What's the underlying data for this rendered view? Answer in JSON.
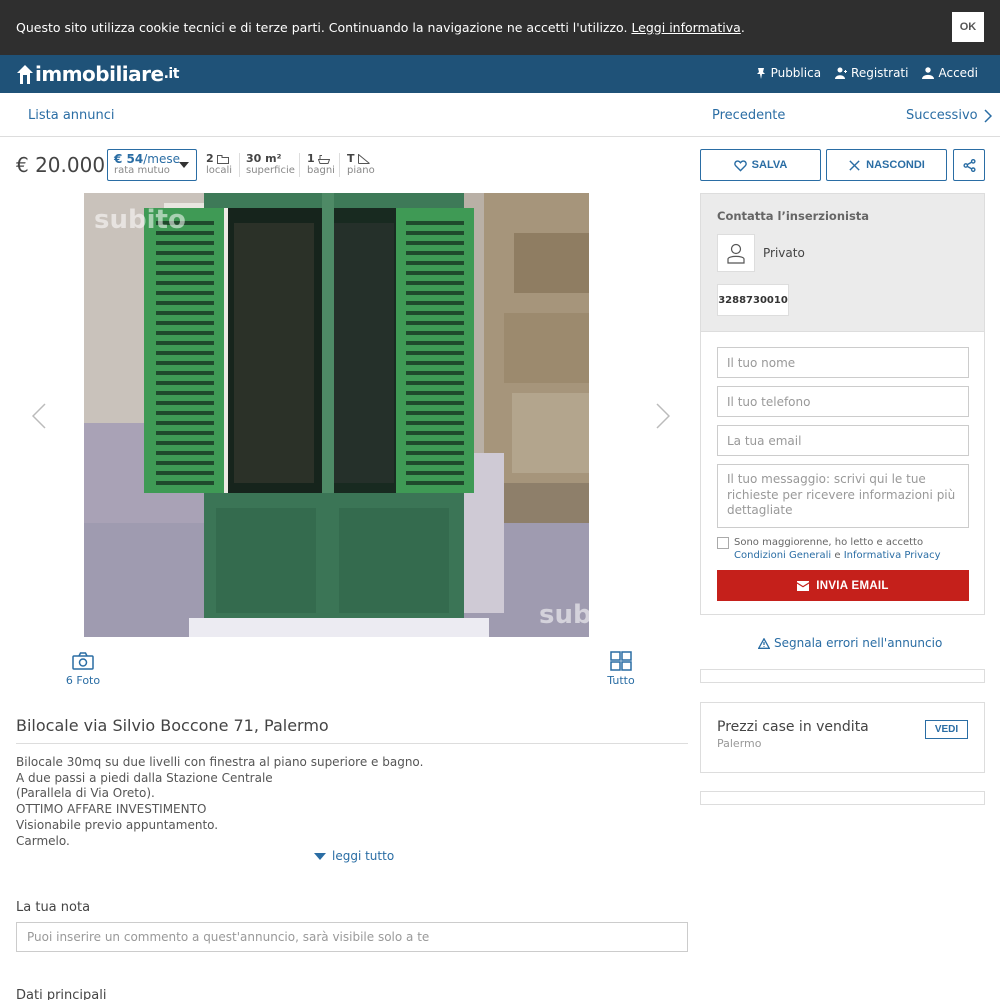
{
  "cookie_bar": {
    "text": "Questo sito utilizza cookie tecnici e di terze parti. Continuando la navigazione ne accetti l'utilizzo.",
    "link": "Leggi informativa",
    "suffix": ".",
    "ok_label": "OK"
  },
  "header": {
    "logo_main": "immobiliare",
    "logo_suffix": ".it",
    "nav": {
      "publish": "Pubblica",
      "register": "Registrati",
      "login": "Accedi"
    }
  },
  "subnav": {
    "list": "Lista annunci",
    "previous": "Precedente",
    "next": "Successivo"
  },
  "listing": {
    "price": "€ 20.000",
    "mortgage": {
      "amount": "€ 54",
      "unit": "/mese",
      "label": "rata mutuo"
    },
    "features": [
      {
        "value": "2",
        "label": "locali"
      },
      {
        "value": "30 m²",
        "label": "superficie"
      },
      {
        "value": "1",
        "label": "bagni"
      },
      {
        "value": "T",
        "label": "piano"
      }
    ],
    "actions": {
      "save": "SALVA",
      "hide": "NASCONDI"
    },
    "gallery": {
      "photos_label": "6 Foto",
      "all_label": "Tutto",
      "watermark": "subito"
    },
    "title": "Bilocale via Silvio Boccone 71, Palermo",
    "description": [
      "Bilocale 30mq su due livelli con finestra al piano superiore e bagno.",
      "A due passi a piedi dalla Stazione Centrale",
      "(Parallela di Via Oreto).",
      "OTTIMO AFFARE INVESTIMENTO",
      "Visionabile previo appuntamento.",
      "Carmelo."
    ],
    "read_more": "leggi tutto",
    "note": {
      "label": "La tua nota",
      "placeholder": "Puoi inserire un commento a quest'annuncio, sarà visibile solo a te"
    },
    "main_data_heading": "Dati principali"
  },
  "contact": {
    "heading": "Contatta l’inserzionista",
    "advertiser": "Privato",
    "phone": "3288730010",
    "name_placeholder": "Il tuo nome",
    "phone_placeholder": "Il tuo telefono",
    "email_placeholder": "La tua email",
    "message_placeholder": "Il tuo messaggio: scrivi qui le tue richieste per ricevere informazioni più dettagliate",
    "consent_prefix": "Sono maggiorenne, ho letto e accetto",
    "consent_link1": "Condizioni Generali",
    "consent_and": "e",
    "consent_link2": "Informativa Privacy",
    "send": "INVIA EMAIL"
  },
  "report": "Segnala errori nell'annuncio",
  "prices_box": {
    "title": "Prezzi case in vendita",
    "subtitle": "Palermo",
    "button": "VEDI"
  },
  "colors": {
    "header_bg": "#1f5278",
    "link_blue": "#2a6da4",
    "send_red": "#c5201b",
    "cookie_bg": "#2f2f2f"
  }
}
